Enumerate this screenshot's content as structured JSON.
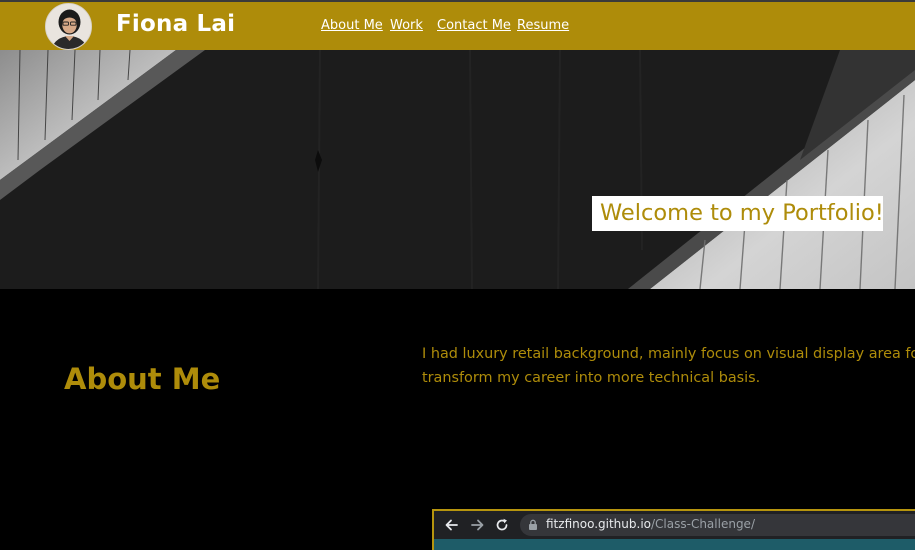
{
  "header": {
    "brand_name": "Fiona Lai",
    "avatar_icon": "profile-photo-avatar",
    "nav": [
      {
        "label": "About Me"
      },
      {
        "label": "Work"
      },
      {
        "label": "Contact Me"
      },
      {
        "label": "Resume"
      }
    ]
  },
  "hero": {
    "welcome_text": "Welcome to my Portfolio!"
  },
  "about": {
    "title": "About Me",
    "line1": "I had luxury retail background, mainly focus on visual display area fo",
    "line2": "transform my career into more technical basis."
  },
  "preview": {
    "back_icon": "arrow-left-icon",
    "forward_icon": "arrow-right-icon",
    "reload_icon": "reload-icon",
    "lock_icon": "lock-icon",
    "url_host": "fitzfinoo.github.io",
    "url_path": "/Class-Challenge/"
  },
  "colors": {
    "accent": "#ae8c0a",
    "background": "#000000",
    "hero_box": "#ffffff"
  }
}
